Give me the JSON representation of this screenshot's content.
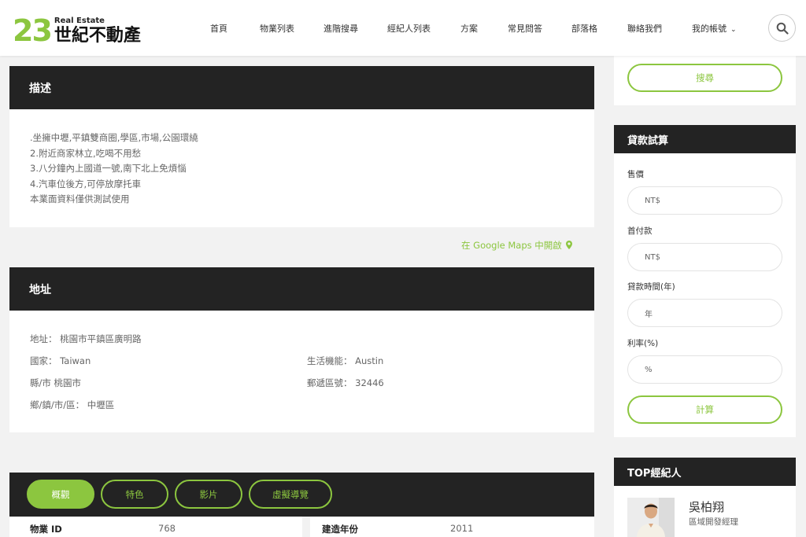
{
  "header": {
    "logo_number": "23",
    "logo_en": "Real Estate",
    "logo_zh": "世紀不動產",
    "nav": [
      "首頁",
      "物業列表",
      "進階搜尋",
      "經紀人列表",
      "方案",
      "常見問答",
      "部落格",
      "聯絡我們",
      "我的帳號"
    ],
    "search_icon": "search-icon"
  },
  "description": {
    "title": "描述",
    "lines": [
      ".坐擁中壢,平鎮雙商圈,學區,市場,公園環繞",
      "2.附近商家林立,吃喝不用愁",
      "3.八分鐘內上國道一號,南下北上免煩惱",
      "4.汽車位後方,可停放摩托車",
      "本業面資料僅供測試使用"
    ]
  },
  "maps_link": "在 Google Maps 中開啟",
  "address": {
    "title": "地址",
    "address_label": "地址：",
    "address_value": "桃園市平鎮區廣明路",
    "country_label": "國家：",
    "country_value": "Taiwan",
    "county_label": "縣/市",
    "county_value": "桃園市",
    "district_label": "鄉/鎮/市/區：",
    "district_value": "中壢區",
    "life_label": "生活機能：",
    "life_value": "Austin",
    "zip_label": "郵遞區號：",
    "zip_value": "32446"
  },
  "tabs": {
    "items": [
      "概觀",
      "特色",
      "影片",
      "虛擬導覽"
    ],
    "active_index": 0
  },
  "overview": {
    "id_label": "物業 ID",
    "id_value": "768",
    "year_label": "建造年份",
    "year_value": "2011"
  },
  "sidebar": {
    "search_button": "搜尋",
    "calc": {
      "title": "貸款試算",
      "price_label": "售價",
      "price_placeholder": "NT$",
      "down_label": "首付款",
      "down_placeholder": "NT$",
      "term_label": "貸款時間(年)",
      "term_placeholder": "年",
      "rate_label": "利率(%)",
      "rate_placeholder": "%",
      "calc_button": "計算"
    },
    "top_agents": {
      "title": "TOP經紀人",
      "agent_name": "吳柏翔",
      "agent_title": "區域開發經理"
    }
  },
  "colors": {
    "accent": "#8cc63f",
    "dark": "#232323",
    "background": "#f2f2f2"
  }
}
